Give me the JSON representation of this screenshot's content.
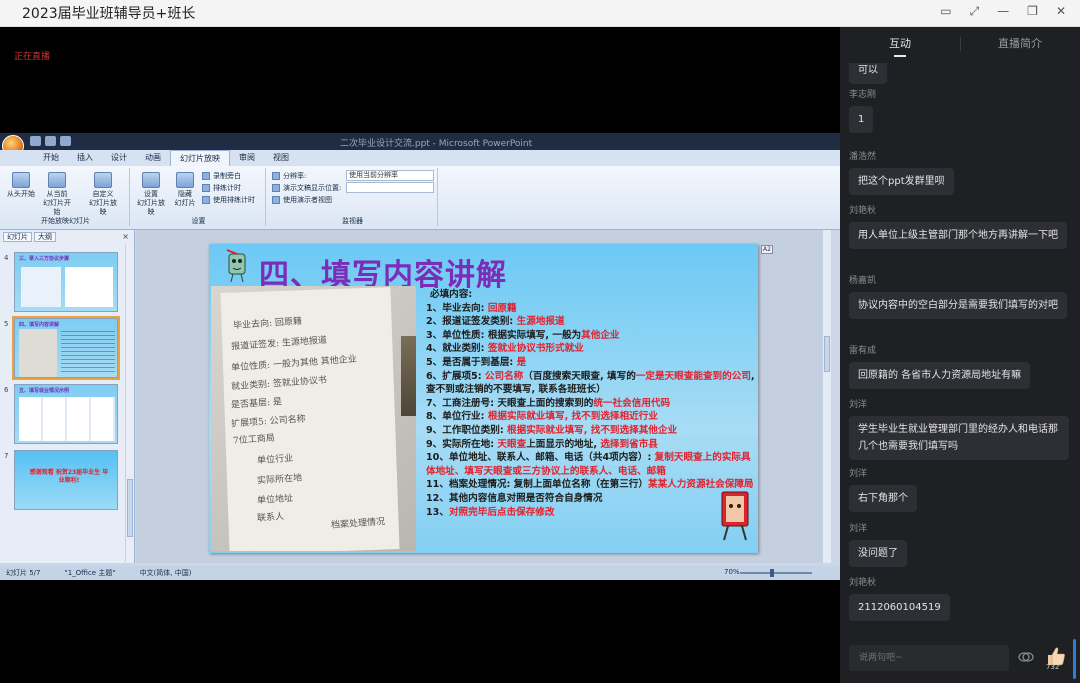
{
  "window": {
    "title": "2023届毕业班辅导员+班长"
  },
  "video": {
    "overlay_text": "正在直播"
  },
  "ppt": {
    "window_title": "二次毕业设计交流.ppt - Microsoft PowerPoint",
    "tabs": [
      "开始",
      "插入",
      "设计",
      "动画",
      "幻灯片放映",
      "审阅",
      "视图"
    ],
    "active_tab": "幻灯片放映",
    "ribbon": {
      "group1_label": "开始放映幻灯片",
      "btn_from_start": "从头开始",
      "btn_from_current": "从当前\n幻灯片开始",
      "btn_custom": "自定义\n幻灯片放映",
      "group2_label": "设置",
      "btn_setup": "设置\n幻灯片放映",
      "btn_hide": "隐藏\n幻灯片",
      "opt_record": "录制旁白",
      "opt_rehearse": "排练计时",
      "opt_use_timing": "使用排练计时",
      "group3_label": "监视器",
      "opt_resolution": "分辨率:",
      "res_value": "使用当前分辨率",
      "opt_show_on": "演示文稿显示位置:",
      "opt_presenter": "使用演示者视图"
    },
    "panel": {
      "tab_slides": "幻灯片",
      "tab_outline": "大纲",
      "close": "×",
      "thumbs": [
        {
          "num": "4",
          "title": "三、录入三方协议步骤"
        },
        {
          "num": "5",
          "title": "四、填写内容讲解"
        },
        {
          "num": "6",
          "title": "五、填写就业情况示例"
        },
        {
          "num": "7",
          "title": "感谢观看 祝贺23届毕业生 毕业顺利!"
        }
      ]
    },
    "slide": {
      "title": "四、填写内容讲解",
      "corner": "A2",
      "header": "必填内容:",
      "lines": [
        [
          {
            "t": "1、毕业去向: "
          },
          {
            "t": "回原籍",
            "red": true
          }
        ],
        [
          {
            "t": "2、报道证签发类别: "
          },
          {
            "t": "生源地报道",
            "red": true
          }
        ],
        [
          {
            "t": "3、单位性质: 根据实际填写, 一般为"
          },
          {
            "t": "其他企业",
            "red": true
          }
        ],
        [
          {
            "t": "4、就业类别: "
          },
          {
            "t": "签就业协议书形式就业",
            "red": true
          }
        ],
        [
          {
            "t": "5、是否属于到基层: "
          },
          {
            "t": "是",
            "red": true
          }
        ],
        [
          {
            "t": "6、扩展项5: "
          },
          {
            "t": "公司名称",
            "red": true
          },
          {
            "t": "（百度搜索天眼查, 填写的"
          },
          {
            "t": "一定是天眼查能查到的公司",
            "red": true
          },
          {
            "t": ", 查不到或注销的不要填写, 联系各班班长）"
          }
        ],
        [
          {
            "t": "7、工商注册号: 天眼查上面的搜索到的"
          },
          {
            "t": "统一社会信用代码",
            "red": true
          }
        ],
        [
          {
            "t": "8、单位行业: "
          },
          {
            "t": "根据实际就业填写, 找不到选择相近行业",
            "red": true
          }
        ],
        [
          {
            "t": "9、工作职位类别: "
          },
          {
            "t": "根据实际就业填写, 找不到选择其他企业",
            "red": true
          }
        ],
        [
          {
            "t": "9、实际所在地: "
          },
          {
            "t": "天眼查",
            "red": true
          },
          {
            "t": "上面显示的地址, "
          },
          {
            "t": "选择到省市县",
            "red": true
          }
        ],
        [
          {
            "t": "10、单位地址、联系人、邮箱、电话（共4项内容）: "
          },
          {
            "t": "复制天眼查上的实际具体地址、填写天眼查或三方协议上的联系人、电话、邮箱",
            "red": true
          }
        ],
        [
          {
            "t": "11、档案处理情况: 复制上面单位名称（在第三行）"
          },
          {
            "t": "某某人力资源社会保障局",
            "red": true
          }
        ],
        [
          {
            "t": "12、其他内容信息对照是否符合自身情况"
          }
        ],
        [
          {
            "t": "13、"
          },
          {
            "t": "对照完毕后点击保存修改",
            "red": true
          }
        ]
      ],
      "handwriting": [
        "毕业去向: 回原籍",
        "报道证签发: 生源地报道",
        "单位性质: 一般为其他 其他企业",
        "就业类别: 签就业协议书",
        "是否基层: 是",
        "扩展项5: 公司名称",
        "7位工商局",
        "单位行业",
        "实际所在地",
        "单位地址",
        "联系人",
        "档案处理情况"
      ]
    },
    "status": {
      "slide_pos": "幻灯片 5/7",
      "theme": "\"1_Office 主题\"",
      "lang": "中文(简体, 中国)",
      "zoom": "70%"
    }
  },
  "sidebar": {
    "tab_interact": "互动",
    "tab_intro": "直播简介",
    "messages": [
      {
        "who": "",
        "text": "可以"
      },
      {
        "who": "李志刚",
        "text": "1"
      },
      {
        "who": "潘浩然",
        "text": "把这个ppt发群里呗"
      },
      {
        "who": "刘艳秋",
        "text": "用人单位上级主管部门那个地方再讲解一下吧"
      },
      {
        "who": "杨嘉凯",
        "text": "协议内容中的空白部分是需要我们填写的对吧"
      },
      {
        "who": "雷有成",
        "text": "回原籍的 各省市人力资源局地址有嘛"
      },
      {
        "who": "刘洋",
        "text": "学生毕业生就业管理部门里的经办人和电话那几个也需要我们填写吗"
      },
      {
        "who": "刘洋",
        "text": "右下角那个"
      },
      {
        "who": "刘洋",
        "text": "没问题了"
      },
      {
        "who": "刘艳秋",
        "text": "2112060104519"
      }
    ],
    "input_placeholder": "说两句吧~",
    "like_count": "732"
  }
}
